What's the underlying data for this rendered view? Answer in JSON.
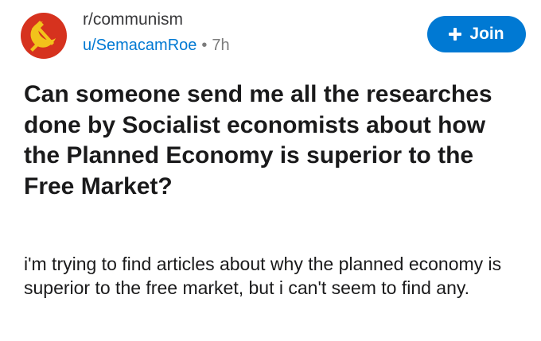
{
  "post": {
    "subreddit": "r/communism",
    "author": "u/SemacamRoe",
    "separator": "•",
    "age": "7h",
    "join_label": "Join",
    "title": "Can someone send me all the researches done by Socialist economists about how the Planned Economy is superior to the Free Market?",
    "body": "i'm trying to find articles about why the planned economy is superior to the free market, but i can't seem to find any."
  },
  "icons": {
    "avatar": "hammer-and-sickle-icon",
    "join": "plus-icon"
  },
  "colors": {
    "avatar_background": "#d6321e",
    "avatar_emblem": "#f2c21b",
    "join_button": "#0079d3",
    "username": "#0079d3",
    "muted_text": "#7c7c7c",
    "primary_text": "#1a1a1b"
  }
}
